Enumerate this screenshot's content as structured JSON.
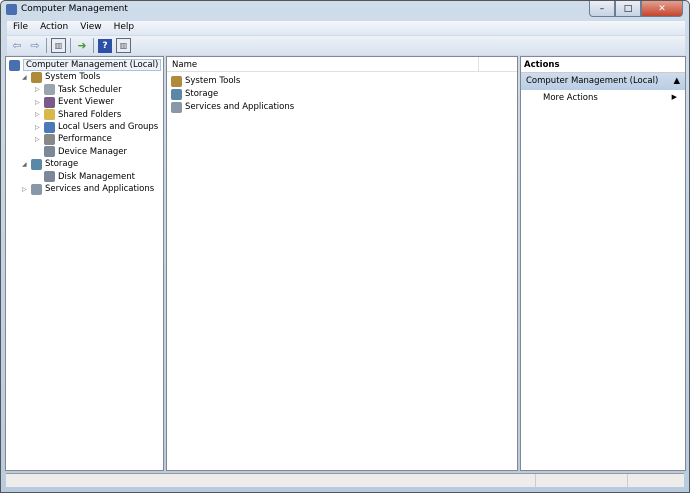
{
  "window": {
    "title": "Computer Management",
    "minimize": "–",
    "maximize": "□",
    "close": "✕"
  },
  "menu": [
    "File",
    "Action",
    "View",
    "Help"
  ],
  "toolbar": {
    "back": "⇦",
    "forward": "⇨",
    "help": "?"
  },
  "tree": [
    {
      "label": "Computer Management (Local)",
      "level": 0,
      "expander": "",
      "color": "#4a6fb0"
    },
    {
      "label": "System Tools",
      "level": 1,
      "expander": "◢",
      "color": "#b08a3a"
    },
    {
      "label": "Task Scheduler",
      "level": 2,
      "expander": "▷",
      "color": "#9aa4ae"
    },
    {
      "label": "Event Viewer",
      "level": 2,
      "expander": "▷",
      "color": "#7a5a8a"
    },
    {
      "label": "Shared Folders",
      "level": 2,
      "expander": "▷",
      "color": "#d8b848"
    },
    {
      "label": "Local Users and Groups",
      "level": 2,
      "expander": "▷",
      "color": "#4a78b8"
    },
    {
      "label": "Performance",
      "level": 2,
      "expander": "▷",
      "color": "#888888"
    },
    {
      "label": "Device Manager",
      "level": 2,
      "expander": "",
      "color": "#7a8898"
    },
    {
      "label": "Storage",
      "level": 1,
      "expander": "◢",
      "color": "#5a88a8"
    },
    {
      "label": "Disk Management",
      "level": 2,
      "expander": "",
      "color": "#7a8898"
    },
    {
      "label": "Services and Applications",
      "level": 1,
      "expander": "▷",
      "color": "#8898a8"
    }
  ],
  "list": {
    "column": "Name",
    "items": [
      {
        "label": "System Tools",
        "color": "#b08a3a"
      },
      {
        "label": "Storage",
        "color": "#5a88a8"
      },
      {
        "label": "Services and Applications",
        "color": "#8898a8"
      }
    ]
  },
  "actions": {
    "header": "Actions",
    "section": "Computer Management (Local)",
    "collapse": "▲",
    "more": "More Actions",
    "more_arrow": "▶"
  }
}
